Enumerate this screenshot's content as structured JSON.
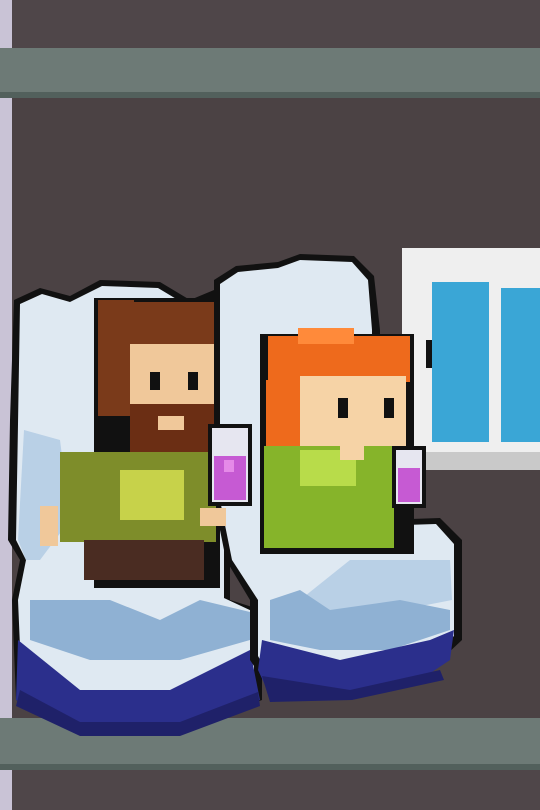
{
  "scene": {
    "description_free": true,
    "palette": {
      "wall": "#4f4649",
      "wall_dark": "#3e3739",
      "rail": "#6d7a76",
      "rail_shadow": "#52605c",
      "left_edge": "#c9c3d6",
      "seat_light": "#dfe9f2",
      "seat_mid": "#b9d0e6",
      "seat_shadow": "#8fb1d3",
      "seat_base": "#2b2f8c",
      "seat_base_dark": "#1f2169",
      "outline": "#111111",
      "window_frame": "#efefef",
      "window_frame_shade": "#c9c9c9",
      "window_glass": "#3aa6d6",
      "man_hair": "#7a3a1a",
      "man_skin": "#f0c89a",
      "man_beard": "#6b2e14",
      "man_shirt": "#7e8d2a",
      "man_shirt_light": "#c7d24a",
      "man_pants": "#4a2c22",
      "woman_hair": "#ee6a1c",
      "woman_hair_light": "#ff8a3a",
      "woman_skin": "#f6d3a6",
      "woman_dress": "#86b42a",
      "woman_dress_light": "#b8dc4a",
      "drink": "#c65ad3",
      "drink_light": "#e58ae8",
      "cup": "#e6e6f0"
    }
  }
}
